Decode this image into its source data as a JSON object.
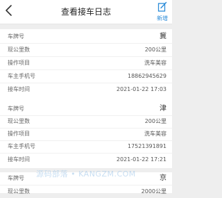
{
  "header": {
    "title": "查看接车日志",
    "add_label": "新增"
  },
  "fields": {
    "plate": "车牌号",
    "mileage": "现公里数",
    "operation": "操作项目",
    "phone": "车主手机号",
    "time": "接车时间"
  },
  "records": [
    {
      "plate": "冀",
      "mileage": "200公里",
      "operation": "洗车美容",
      "phone": "18862945629",
      "time": "2021-01-22 17:03"
    },
    {
      "plate": "津",
      "mileage": "200公里",
      "operation": "洗车美容",
      "phone": "17521391891",
      "time": "2021-01-22 17:21"
    },
    {
      "plate": "京",
      "mileage": "2000公里"
    }
  ],
  "watermark": "源码部落 • KANGZM.COM",
  "icons": {
    "back": "chevron-left-icon",
    "add": "edit-square-icon"
  },
  "colors": {
    "accent": "#2a8bd8",
    "background": "#eeeeee"
  }
}
